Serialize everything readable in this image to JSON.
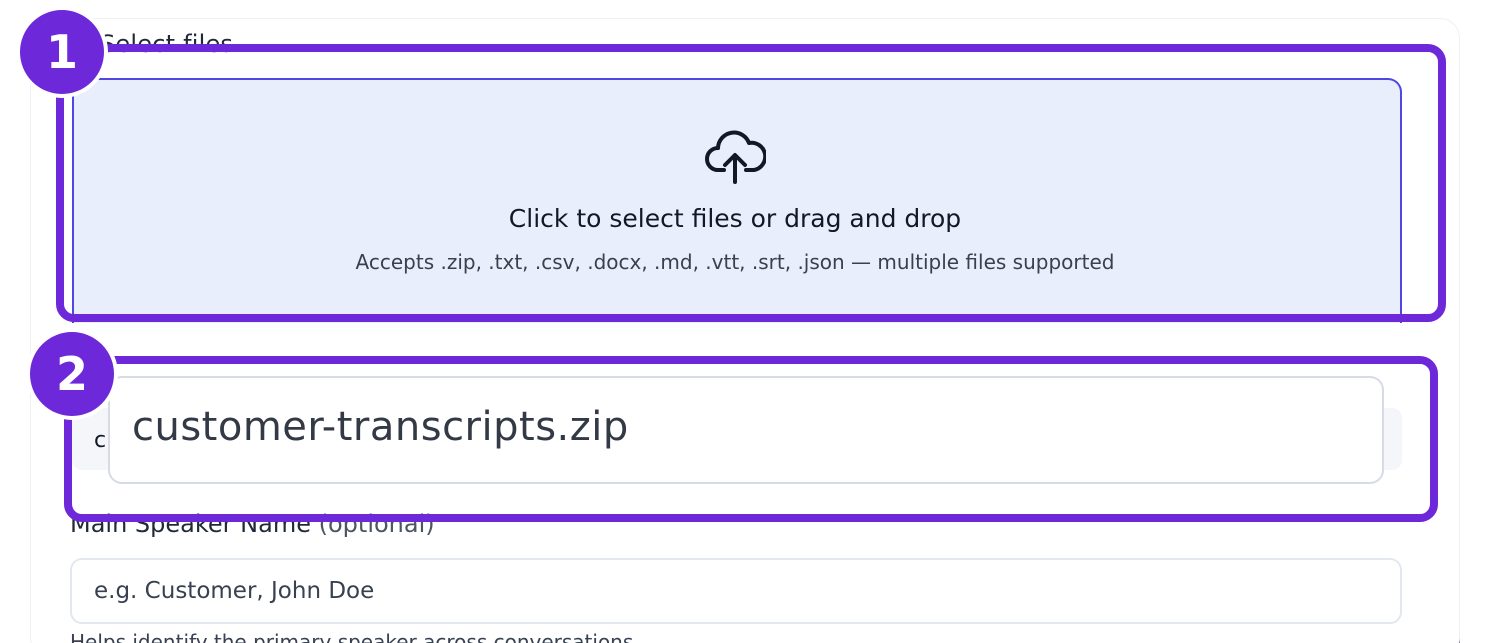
{
  "upload": {
    "section_label": "Select files",
    "title": "Click to select files or drag and drop",
    "accepts": "Accepts .zip, .txt, .csv, .docx, .md, .vtt, .srt, .json — multiple files supported",
    "icon": "cloud-upload-icon"
  },
  "selected_file": {
    "row_letter": "c",
    "name": "customer-transcripts.zip"
  },
  "speaker": {
    "label": "Main Speaker Name",
    "optional": "(optional)",
    "placeholder": "e.g. Customer, John Doe",
    "help": "Helps identify the primary speaker across conversations"
  },
  "annotations": [
    {
      "number": "1"
    },
    {
      "number": "2"
    }
  ],
  "colors": {
    "accent": "#6d28d9",
    "dropzone_bg": "#e8eefb",
    "dropzone_border": "#4f46e5"
  }
}
